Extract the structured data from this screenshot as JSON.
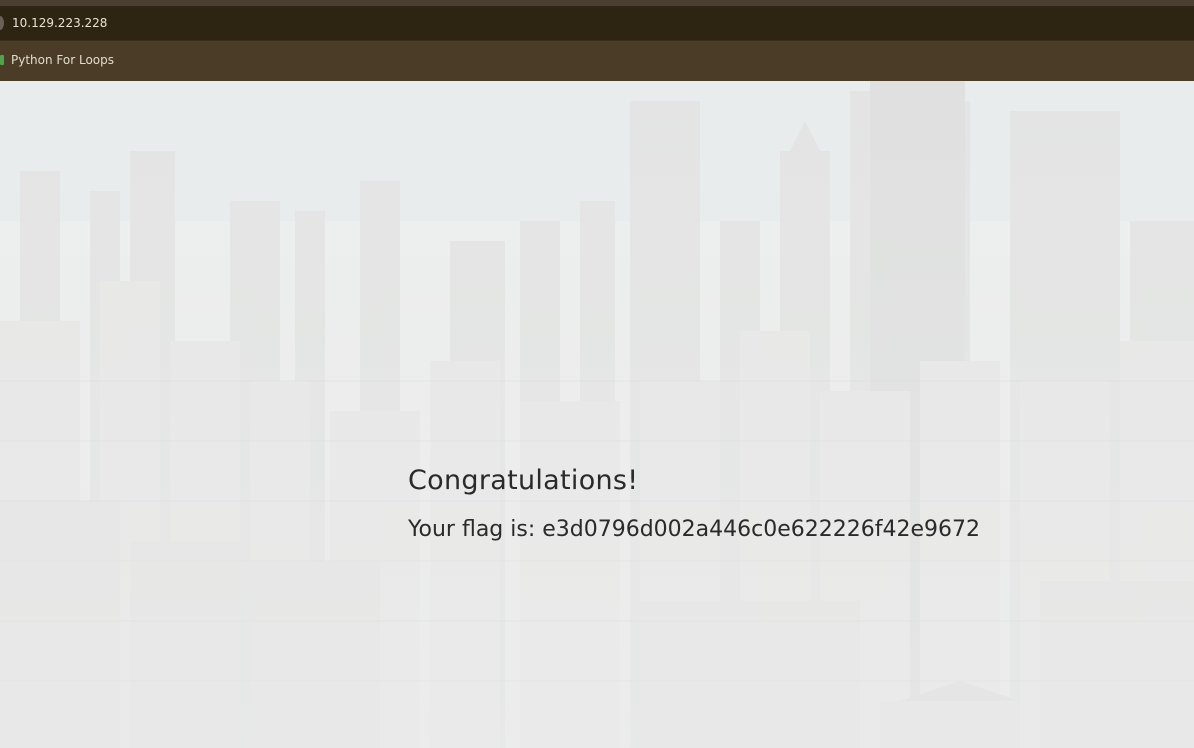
{
  "browser": {
    "address": "10.129.223.228",
    "bookmarks": [
      {
        "label": "Python For Loops",
        "icon": "python-icon"
      }
    ]
  },
  "page": {
    "heading": "Congratulations!",
    "flag_text": "Your flag is: e3d0796d002a446c0e622226f42e9672"
  },
  "colors": {
    "address_bar": "#2d2412",
    "bookmarks_bar": "#4a3c27",
    "page_background": "#eceded",
    "text": "#2a2a2a"
  }
}
